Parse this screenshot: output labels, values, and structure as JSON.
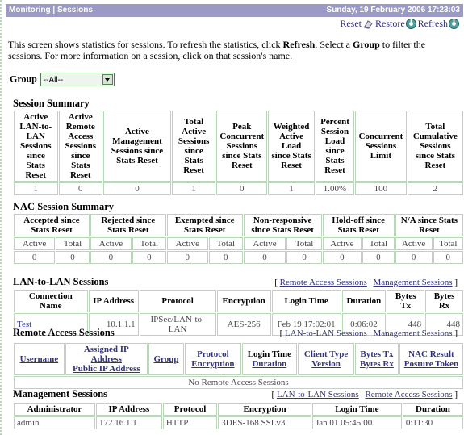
{
  "titlebar": {
    "title": "Monitoring | Sessions",
    "datetime": "Sunday, 19 February 2006 17:23:03"
  },
  "actions": {
    "reset": "Reset",
    "restore": "Restore",
    "refresh": "Refresh"
  },
  "intro": {
    "part1": "This screen shows statistics for sessions. To refresh the statistics, click ",
    "bold1": "Refresh",
    "part2": ". Select a ",
    "bold2": "Group",
    "part3": " to filter the sessions. For more information on a session, click on that session's name."
  },
  "group": {
    "label": "Group",
    "selected": "--All--"
  },
  "session_summary": {
    "heading": "Session Summary",
    "headers": [
      "Active LAN-to-LAN Sessions since Stats Reset",
      "Active Remote Access Sessions since Stats Reset",
      "Active Management Sessions since Stats Reset",
      "Total Active Sessions since Stats Reset",
      "Peak Concurrent Sessions since Stats Reset",
      "Weighted Active Load since Stats Reset",
      "Percent Session Load since Stats Reset",
      "Concurrent Sessions Limit",
      "Total Cumulative Sessions since Stats Reset"
    ],
    "values": [
      "1",
      "0",
      "0",
      "1",
      "0",
      "1",
      "1.00%",
      "100",
      "2"
    ]
  },
  "nac_summary": {
    "heading": "NAC Session Summary",
    "groups": [
      "Accepted since Stats Reset",
      "Rejected since Stats Reset",
      "Exempted since Stats Reset",
      "Non-responsive since Stats Reset",
      "Hold-off since Stats Reset",
      "N/A since Stats Reset"
    ],
    "sub_active": "Active",
    "sub_total": "Total",
    "values": [
      "0",
      "0",
      "0",
      "0",
      "0",
      "0",
      "0",
      "0",
      "0",
      "0",
      "0",
      "0"
    ]
  },
  "lan_to_lan": {
    "heading": "LAN-to-LAN Sessions",
    "links_open": "[",
    "links_close": "]",
    "links_sep": "|",
    "link1": "Remote Access Sessions",
    "link2": "Management Sessions",
    "headers": [
      "Connection Name",
      "IP Address",
      "Protocol",
      "Encryption",
      "Login Time",
      "Duration",
      "Bytes Tx",
      "Bytes Rx"
    ],
    "rows": [
      {
        "connection_name": "Test",
        "ip_address": "10.1.1.1",
        "protocol": "IPSec/LAN-to-LAN",
        "encryption": "AES-256",
        "login_time": "Feb 19 17:02:01",
        "duration": "0:06:02",
        "bytes_tx": "448",
        "bytes_rx": "448"
      }
    ]
  },
  "remote_access": {
    "heading": "Remote Access Sessions",
    "links_open": "[",
    "links_close": "]",
    "links_sep": "|",
    "link1": "LAN-to-LAN Sessions",
    "link2": "Management Sessions",
    "headers": [
      {
        "line1": "Username",
        "line2": ""
      },
      {
        "line1": "Assigned IP Address",
        "line2": "Public IP Address"
      },
      {
        "line1": "Group",
        "line2": ""
      },
      {
        "line1": "Protocol",
        "line2": "Encryption"
      },
      {
        "line1": "Login Time",
        "line2": "Duration"
      },
      {
        "line1": "Client Type",
        "line2": "Version"
      },
      {
        "line1": "Bytes Tx",
        "line2": "Bytes Rx"
      },
      {
        "line1": "NAC Result",
        "line2": "Posture Token"
      }
    ],
    "empty_message": "No Remote Access Sessions"
  },
  "management": {
    "heading": "Management Sessions",
    "links_open": "[",
    "links_close": "]",
    "links_sep": "|",
    "link1": "LAN-to-LAN Sessions",
    "link2": "Remote Access Sessions",
    "headers": [
      "Administrator",
      "IP Address",
      "Protocol",
      "Encryption",
      "Login Time",
      "Duration"
    ],
    "rows": [
      {
        "administrator": "admin",
        "ip_address": "172.16.1.1",
        "protocol": "HTTP",
        "encryption": "3DES-168 SSLv3",
        "login_time": "Jan 01 05:45:00",
        "duration": "0:11:30"
      }
    ]
  },
  "colors": {
    "titlebar_bg": "#9a9ac4",
    "link": "#33337f",
    "table_border": "#bcd3bc",
    "dotted_border": "#b9d6b9"
  }
}
